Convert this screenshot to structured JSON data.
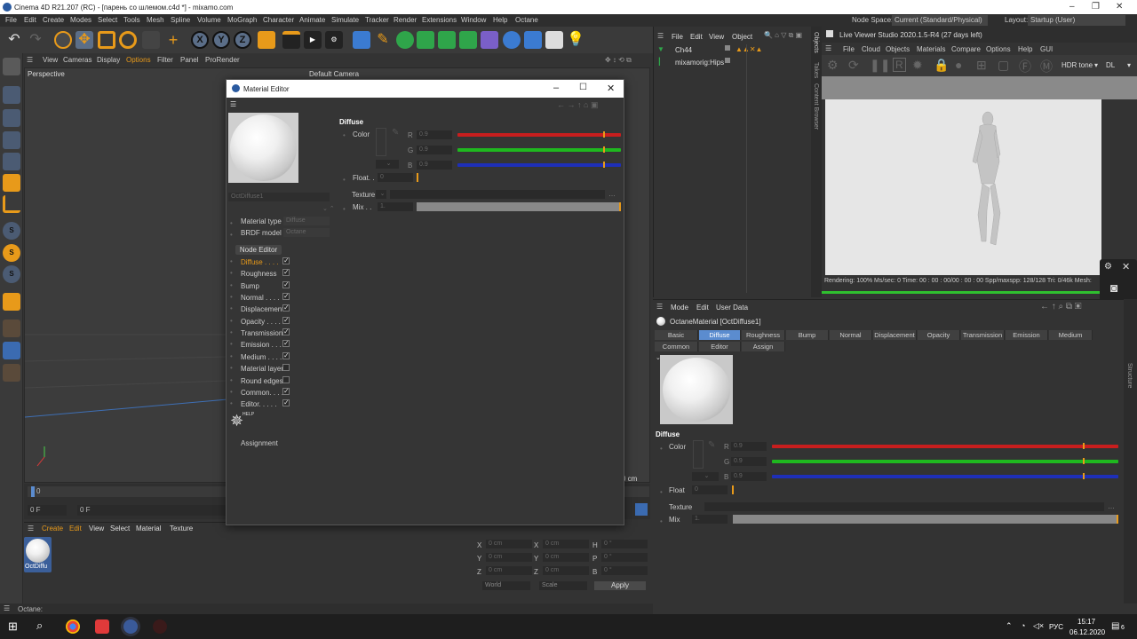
{
  "app": {
    "title": "Cinema 4D R21.207 (RC) - [парень со шлемом.c4d *] - mixamo.com",
    "node_space_label": "Node Space:",
    "node_space_value": "Current (Standard/Physical)",
    "layout_label": "Layout:",
    "layout_value": "Startup (User)"
  },
  "menubar": [
    "File",
    "Edit",
    "Create",
    "Modes",
    "Select",
    "Tools",
    "Mesh",
    "Spline",
    "Volume",
    "MoGraph",
    "Character",
    "Animate",
    "Simulate",
    "Tracker",
    "Render",
    "Extensions",
    "Window",
    "Help",
    "Octane"
  ],
  "viewport": {
    "menu": [
      "View",
      "Cameras",
      "Display",
      "Options",
      "Filter",
      "Panel",
      "ProRender"
    ],
    "name": "Perspective",
    "camera": "Default Camera",
    "cm_readout": "0 cm"
  },
  "timeline": {
    "frame_start": "0 F",
    "frame_current": "0 F",
    "ruler_zero": "0"
  },
  "material_manager": {
    "menu": [
      "Create",
      "Edit",
      "View",
      "Select",
      "Material",
      "Texture"
    ],
    "material_name": "OctDiffu"
  },
  "coords": {
    "rows": [
      {
        "a": "X",
        "av": "0 cm",
        "b": "X",
        "bv": "0 cm",
        "c": "H",
        "cv": "0 °"
      },
      {
        "a": "Y",
        "av": "0 cm",
        "b": "Y",
        "bv": "0 cm",
        "c": "P",
        "cv": "0 °"
      },
      {
        "a": "Z",
        "av": "0 cm",
        "b": "Z",
        "bv": "0 cm",
        "c": "B",
        "cv": "0 °"
      }
    ],
    "world": "World",
    "scale": "Scale",
    "apply": "Apply"
  },
  "statusbar": "Octane:",
  "object_manager": {
    "menu": [
      "File",
      "Edit",
      "View",
      "Object"
    ],
    "items": [
      "Ch44",
      "mixamorig:Hips"
    ],
    "side_tabs": [
      "Objects",
      "Takes",
      "Content Browser"
    ]
  },
  "live_viewer": {
    "title": "Live Viewer Studio 2020.1.5-R4 (27 days left)",
    "menu": [
      "File",
      "Cloud",
      "Objects",
      "Materials",
      "Compare",
      "Options",
      "Help",
      "GUI"
    ],
    "tone": "HDR tone",
    "kernel": "DL",
    "status": "Rendering: 100% Ms/sec: 0   Time: 00 : 00 : 00/00 : 00 : 00  Spp/maxspp: 128/128   Tri: 0/46k   Mesh:",
    "progress": 1.0
  },
  "attribute_manager": {
    "menu": [
      "Mode",
      "Edit",
      "User Data"
    ],
    "object_title": "OctaneMaterial [OctDiffuse1]",
    "tabs_row1": [
      "Basic",
      "Diffuse",
      "Roughness",
      "Bump",
      "Normal",
      "Displacement",
      "Opacity",
      "Transmission",
      "Emission",
      "Medium"
    ],
    "tabs_row2": [
      "Common",
      "Editor",
      "Assign"
    ],
    "active_tab": "Diffuse",
    "section": "Diffuse",
    "color_label": "Color",
    "r_label": "R",
    "r_value": "0.9",
    "g_label": "G",
    "g_value": "0.9",
    "b_label": "B",
    "b_value": "0.9",
    "float_label": "Float",
    "float_value": "0",
    "texture_label": "Texture",
    "mix_label": "Mix",
    "mix_value": "1.",
    "structure_tab": "Structure"
  },
  "material_editor": {
    "title": "Material Editor",
    "material_name": "OctDiffuse1",
    "material_type_label": "Material type",
    "material_type_value": "Diffuse",
    "brdf_label": "BRDF model",
    "brdf_value": "Octane",
    "node_editor": "Node Editor",
    "channels": [
      {
        "label": "Diffuse . . . .",
        "checked": true,
        "active": true
      },
      {
        "label": "Roughness",
        "checked": true,
        "active": false
      },
      {
        "label": "Bump",
        "checked": true,
        "active": false
      },
      {
        "label": "Normal . . . .",
        "checked": true,
        "active": false
      },
      {
        "label": "Displacement",
        "checked": true,
        "active": false
      },
      {
        "label": "Opacity . . . .",
        "checked": true,
        "active": false
      },
      {
        "label": "Transmission",
        "checked": true,
        "active": false
      },
      {
        "label": "Emission . . .",
        "checked": true,
        "active": false
      },
      {
        "label": "Medium . . . .",
        "checked": true,
        "active": false
      },
      {
        "label": "Material layer",
        "checked": false,
        "active": false
      },
      {
        "label": "Round edges",
        "checked": false,
        "active": false
      },
      {
        "label": "Common. . . .",
        "checked": true,
        "active": false
      },
      {
        "label": "Editor. . . . .",
        "checked": true,
        "active": false
      }
    ],
    "help": "HELP",
    "assignment": "Assignment",
    "section": "Diffuse",
    "color_label": "Color",
    "r_label": "R",
    "r_value": "0.9",
    "g_label": "G",
    "g_value": "0.9",
    "b_label": "B",
    "b_value": "0.9",
    "float_label": "Float. .",
    "float_value": "0",
    "texture_label": "Texture",
    "mix_label": "Mix . .",
    "mix_value": "1."
  },
  "taskbar": {
    "lang": "РУС",
    "time": "15:17",
    "date": "06.12.2020",
    "notif": "6"
  },
  "colors": {
    "accent": "#5b8ccf",
    "red": "#c81e1e",
    "green": "#1fb81f",
    "blue": "#1e2fb8",
    "orange": "#e89a1a"
  }
}
